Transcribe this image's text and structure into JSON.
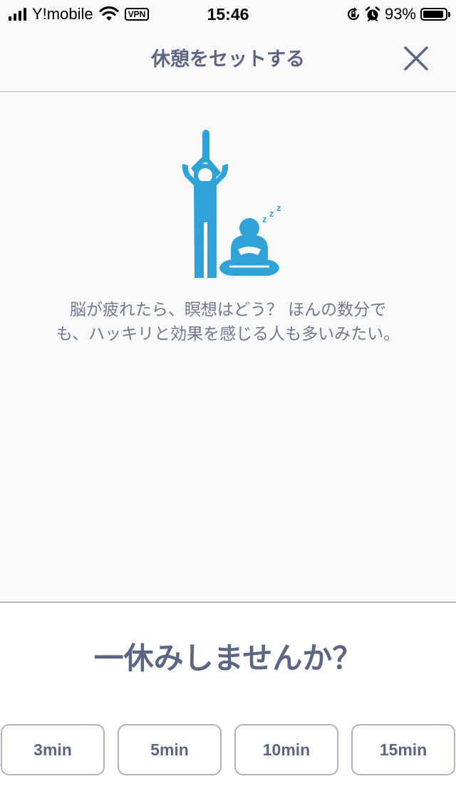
{
  "status_bar": {
    "carrier": "Y!mobile",
    "vpn": "VPN",
    "time": "15:46",
    "battery_percent": "93%",
    "battery_level": 0.93,
    "icons": [
      "signal-icon",
      "wifi-icon",
      "orientation-lock-icon",
      "alarm-icon",
      "battery-icon"
    ]
  },
  "header": {
    "title": "休憩をセットする",
    "close_icon": "close-icon"
  },
  "illustration": {
    "icon": "stretch-and-meditate-icon",
    "sleep_text": "z z z",
    "color": "#2fa2d8"
  },
  "message": {
    "line1": "脳が疲れたら、瞑想はどう？ ほんの数分で",
    "line2": "も、ハッキリと効果を感じる人も多いみたい。"
  },
  "prompt": "一休みしませんか？",
  "durations": [
    "3min",
    "5min",
    "10min",
    "15min"
  ],
  "colors": {
    "text": "#5b6684",
    "accent": "#2fa2d8",
    "background": "#f9f9f9",
    "panel": "#ffffff",
    "border": "#aeb3c2"
  }
}
